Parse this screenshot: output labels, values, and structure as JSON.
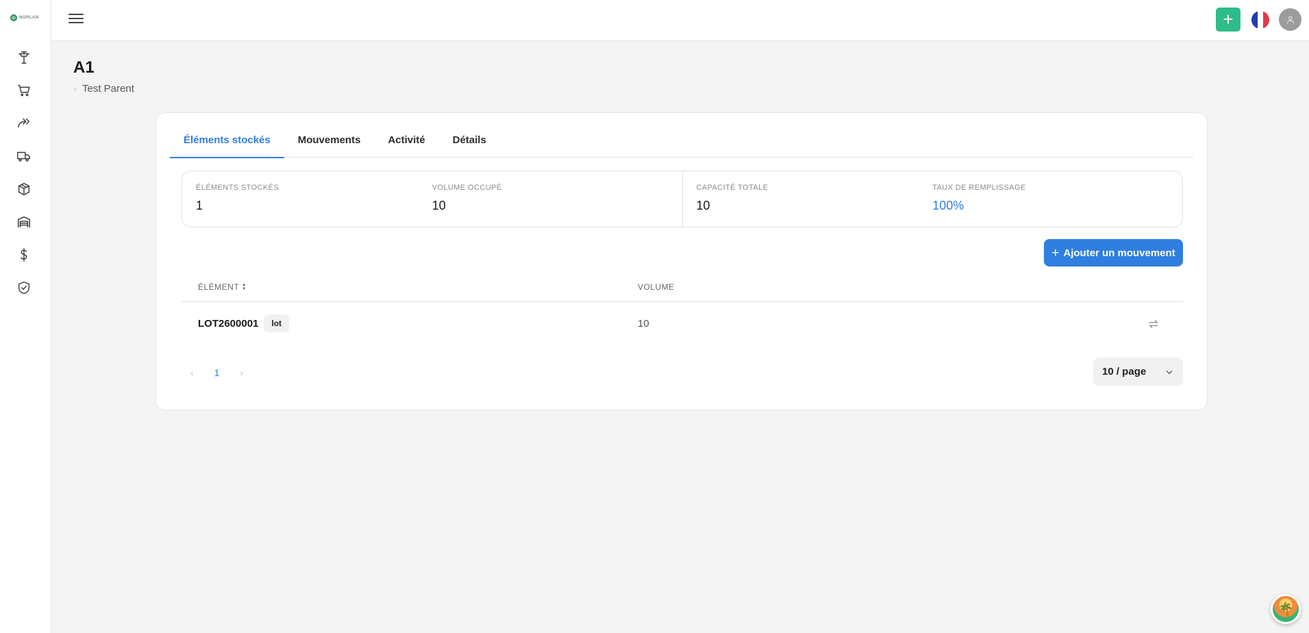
{
  "app": {
    "logo_text": "NORLAN"
  },
  "sidebar": {
    "items": [
      {
        "name": "sidebar-item-dashboard",
        "icon": "tower-icon"
      },
      {
        "name": "sidebar-item-orders",
        "icon": "cart-icon"
      },
      {
        "name": "sidebar-item-transfers",
        "icon": "forward-icon"
      },
      {
        "name": "sidebar-item-shipping",
        "icon": "truck-icon"
      },
      {
        "name": "sidebar-item-products",
        "icon": "box-icon"
      },
      {
        "name": "sidebar-item-warehouse",
        "icon": "warehouse-icon"
      },
      {
        "name": "sidebar-item-billing",
        "icon": "dollar-icon"
      },
      {
        "name": "sidebar-item-security",
        "icon": "shield-check-icon"
      }
    ]
  },
  "header": {
    "add_symbol": "+",
    "language": "fr"
  },
  "page": {
    "title": "A1",
    "breadcrumb_parent": "Test Parent",
    "breadcrumb_chevron": "‹"
  },
  "tabs": [
    {
      "label": "Éléments stockés",
      "active": true
    },
    {
      "label": "Mouvements",
      "active": false
    },
    {
      "label": "Activité",
      "active": false
    },
    {
      "label": "Détails",
      "active": false
    }
  ],
  "stats": [
    {
      "label": "Éléments stockés",
      "value": "1"
    },
    {
      "label": "Volume occupé",
      "value": "10"
    },
    {
      "label": "Capacité totale",
      "value": "10"
    },
    {
      "label": "Taux de remplissage",
      "value": "100%"
    }
  ],
  "actions": {
    "add_movement": "Ajouter un mouvement",
    "add_symbol": "+"
  },
  "table": {
    "columns": {
      "element": "ÉLÉMENT",
      "volume": "VOLUME"
    },
    "rows": [
      {
        "code": "LOT2600001",
        "tag": "lot",
        "volume": "10"
      }
    ]
  },
  "pagination": {
    "prev": "‹",
    "current_page": "1",
    "next": "›",
    "page_size": "10 / page"
  },
  "colors": {
    "accent": "#2f7fe0",
    "add_button": "#2ebd8a"
  }
}
